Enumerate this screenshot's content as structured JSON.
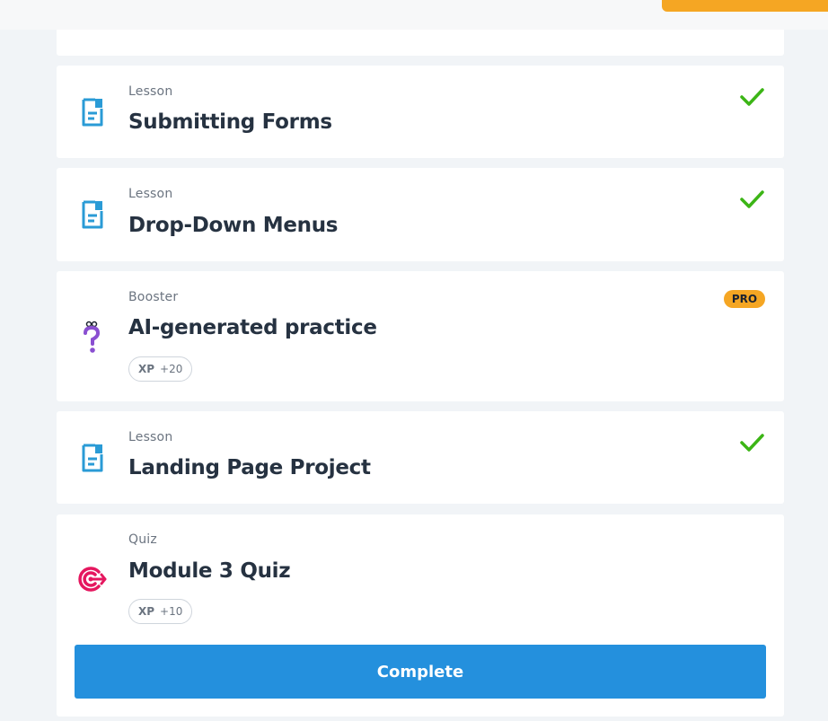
{
  "colors": {
    "accent_orange": "#f5a623",
    "check_green": "#3cb516",
    "lesson_blue": "#2a9bd6",
    "booster_purple": "#8a4fd1",
    "quiz_pink": "#e5175f",
    "button_blue": "#2490dd"
  },
  "lessons": [
    {
      "type": "Lesson",
      "title": "Submitting Forms",
      "icon": "document-icon",
      "status": "completed",
      "status_icon": "check-icon"
    },
    {
      "type": "Lesson",
      "title": "Drop-Down Menus",
      "icon": "document-icon",
      "status": "completed",
      "status_icon": "check-icon"
    },
    {
      "type": "Booster",
      "title": "AI-generated practice",
      "icon": "question-mark-icon",
      "badge": "PRO",
      "xp_label": "XP",
      "xp_value": "+20"
    },
    {
      "type": "Lesson",
      "title": "Landing Page Project",
      "icon": "document-icon",
      "status": "completed",
      "status_icon": "check-icon"
    },
    {
      "type": "Quiz",
      "title": "Module 3 Quiz",
      "icon": "target-icon",
      "xp_label": "XP",
      "xp_value": "+10"
    }
  ],
  "complete_button": {
    "label": "Complete"
  }
}
